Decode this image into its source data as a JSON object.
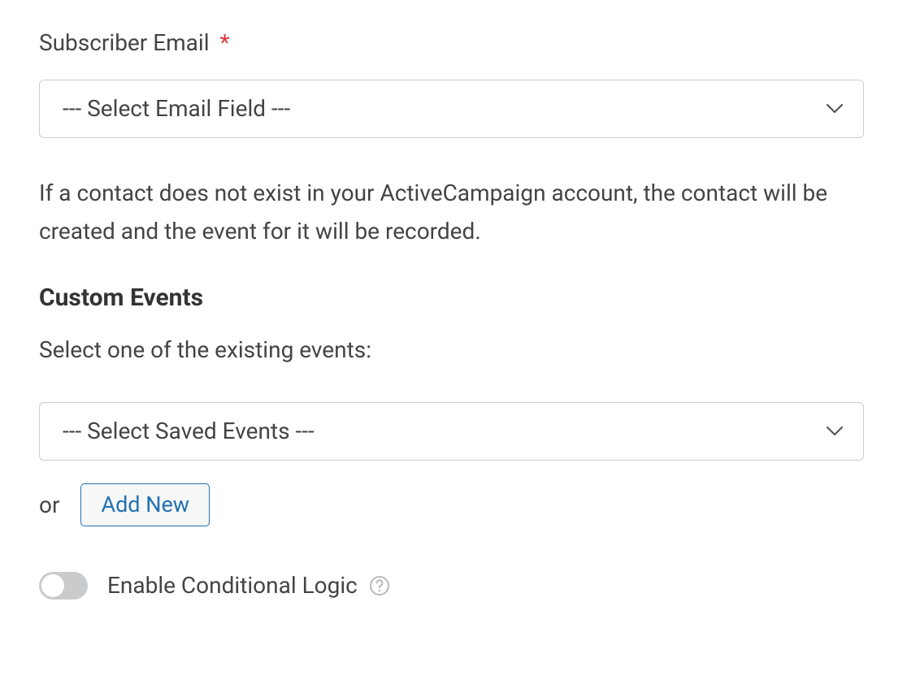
{
  "subscriber_email": {
    "label": "Subscriber Email",
    "required_mark": "*",
    "select_placeholder": "--- Select Email Field ---"
  },
  "contact_help_text": "If a contact does not exist in your ActiveCampaign account, the contact will be created and the event for it will be recorded.",
  "custom_events": {
    "heading": "Custom Events",
    "sub_text": "Select one of the existing events:",
    "select_placeholder": "--- Select Saved Events ---",
    "or_text": "or",
    "add_new_label": "Add New"
  },
  "conditional_logic": {
    "label": "Enable Conditional Logic"
  }
}
